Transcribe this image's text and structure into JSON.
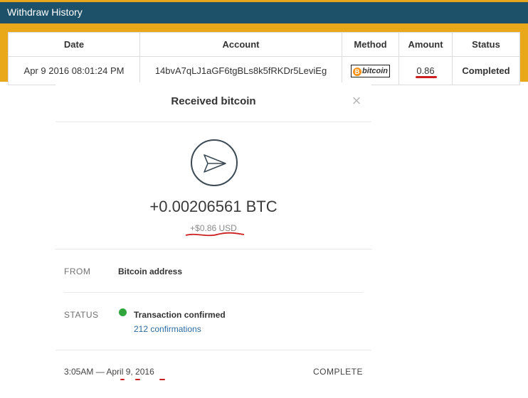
{
  "withdraw_history": {
    "title": "Withdraw History",
    "columns": [
      "Date",
      "Account",
      "Method",
      "Amount",
      "Status"
    ],
    "rows": [
      {
        "date": "Apr 9 2016 08:01:24 PM",
        "account": "14bvA7qLJ1aGF6tgBLs8k5fRKDr5LeviEg",
        "method": "bitcoin",
        "amount": "0.86",
        "status": "Completed"
      }
    ]
  },
  "transaction": {
    "title": "Received bitcoin",
    "close_symbol": "×",
    "amount_btc": "+0.00206561 BTC",
    "amount_usd": "+$0.86 USD",
    "from_label": "FROM",
    "from_value": "Bitcoin address",
    "status_label": "STATUS",
    "status_value": "Transaction confirmed",
    "confirmations": "212 confirmations",
    "date": "3:05AM — April 9, 2016",
    "footer_status": "COMPLETE"
  },
  "colors": {
    "header_bg": "#1d5069",
    "frame": "#e9a71a",
    "completed": "#1a7a1a",
    "confirm_dot": "#2ea63b",
    "link": "#2d6ca2",
    "annotation_red": "#cc1f1f"
  }
}
